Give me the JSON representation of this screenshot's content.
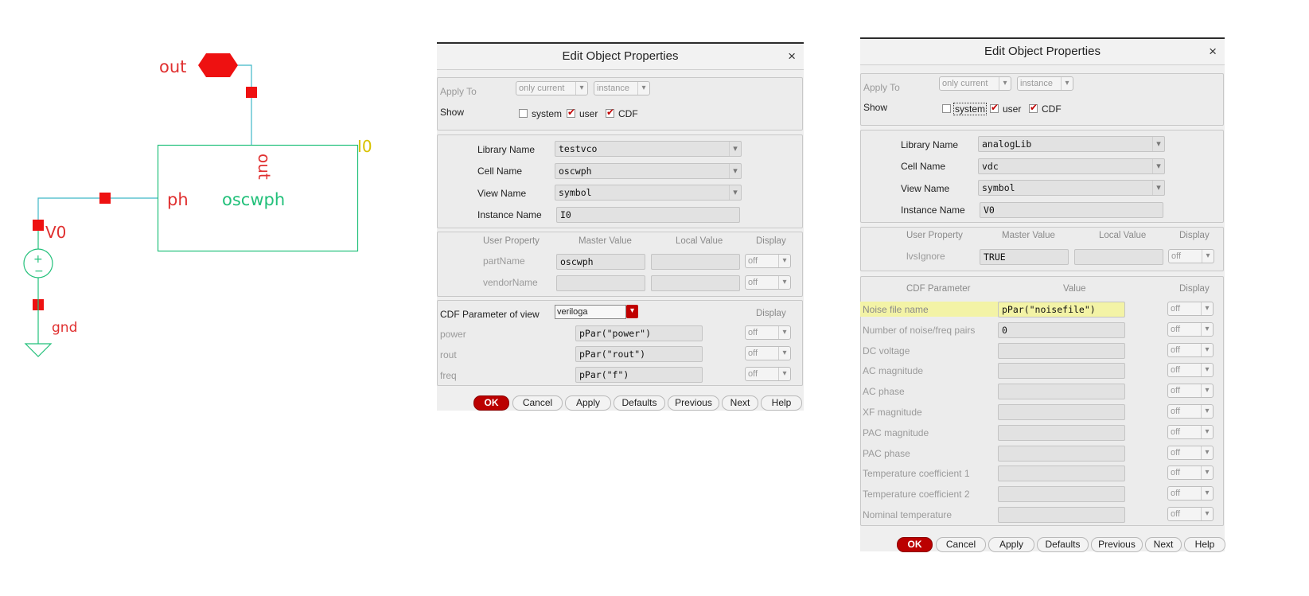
{
  "schematic": {
    "pin_label": "out",
    "instance_ref": "I0",
    "port_out": "out",
    "port_ph": "ph",
    "cell_name": "oscwph",
    "source_ref": "V0",
    "ground_label": "gnd"
  },
  "dialog1": {
    "title": "Edit Object Properties",
    "close": "×",
    "apply_to_label": "Apply To",
    "apply_to_value": "only current",
    "apply_scope_value": "instance",
    "show_label": "Show",
    "show_system": "system",
    "show_user": "user",
    "show_cdf": "CDF",
    "show_system_checked": false,
    "show_user_checked": true,
    "show_cdf_checked": true,
    "library_label": "Library Name",
    "library_value": "testvco",
    "cell_label": "Cell Name",
    "cell_value": "oscwph",
    "view_label": "View Name",
    "view_value": "symbol",
    "instance_label": "Instance Name",
    "instance_value": "I0",
    "prop_headers": {
      "user_property": "User Property",
      "master_value": "Master Value",
      "local_value": "Local Value",
      "display": "Display"
    },
    "props": [
      {
        "name": "partName",
        "master": "oscwph",
        "local": "",
        "display": "off"
      },
      {
        "name": "vendorName",
        "master": "",
        "local": "",
        "display": "off"
      }
    ],
    "cdf_view_label": "CDF Parameter of view",
    "cdf_view_value": "veriloga",
    "cdf_display_header": "Display",
    "cdf_params": [
      {
        "name": "power",
        "value": "pPar(\"power\")",
        "display": "off"
      },
      {
        "name": "rout",
        "value": "pPar(\"rout\")",
        "display": "off"
      },
      {
        "name": "freq",
        "value": "pPar(\"f\")",
        "display": "off"
      }
    ],
    "buttons": {
      "ok": "OK",
      "cancel": "Cancel",
      "apply": "Apply",
      "defaults": "Defaults",
      "previous": "Previous",
      "next": "Next",
      "help": "Help"
    }
  },
  "dialog2": {
    "title": "Edit Object Properties",
    "close": "×",
    "apply_to_label": "Apply To",
    "apply_to_value": "only current",
    "apply_scope_value": "instance",
    "show_label": "Show",
    "show_system": "system",
    "show_user": "user",
    "show_cdf": "CDF",
    "show_system_checked": false,
    "show_user_checked": true,
    "show_cdf_checked": true,
    "library_label": "Library Name",
    "library_value": "analogLib",
    "cell_label": "Cell Name",
    "cell_value": "vdc",
    "view_label": "View Name",
    "view_value": "symbol",
    "instance_label": "Instance Name",
    "instance_value": "V0",
    "prop_headers": {
      "user_property": "User Property",
      "master_value": "Master Value",
      "local_value": "Local Value",
      "display": "Display"
    },
    "props": [
      {
        "name": "lvsIgnore",
        "master": "TRUE",
        "local": "",
        "display": "off"
      }
    ],
    "cdf_headers": {
      "param": "CDF Parameter",
      "value": "Value",
      "display": "Display"
    },
    "cdf_params": [
      {
        "name": "Noise file name",
        "value": "pPar(\"noisefile\")",
        "display": "off"
      },
      {
        "name": "Number of noise/freq pairs",
        "value": "0",
        "display": "off"
      },
      {
        "name": "DC voltage",
        "value": "",
        "display": "off"
      },
      {
        "name": "AC magnitude",
        "value": "",
        "display": "off"
      },
      {
        "name": "AC phase",
        "value": "",
        "display": "off"
      },
      {
        "name": "XF magnitude",
        "value": "",
        "display": "off"
      },
      {
        "name": "PAC magnitude",
        "value": "",
        "display": "off"
      },
      {
        "name": "PAC phase",
        "value": "",
        "display": "off"
      },
      {
        "name": "Temperature coefficient 1",
        "value": "",
        "display": "off"
      },
      {
        "name": "Temperature coefficient 2",
        "value": "",
        "display": "off"
      },
      {
        "name": "Nominal temperature",
        "value": "",
        "display": "off"
      }
    ],
    "buttons": {
      "ok": "OK",
      "cancel": "Cancel",
      "apply": "Apply",
      "defaults": "Defaults",
      "previous": "Previous",
      "next": "Next",
      "help": "Help"
    }
  },
  "colors": {
    "wire": "#19b36b",
    "pin_red": "#e60000",
    "ok_button": "#bb0000",
    "highlight": "#f3f3a6",
    "instance_label": "#d8c200"
  }
}
